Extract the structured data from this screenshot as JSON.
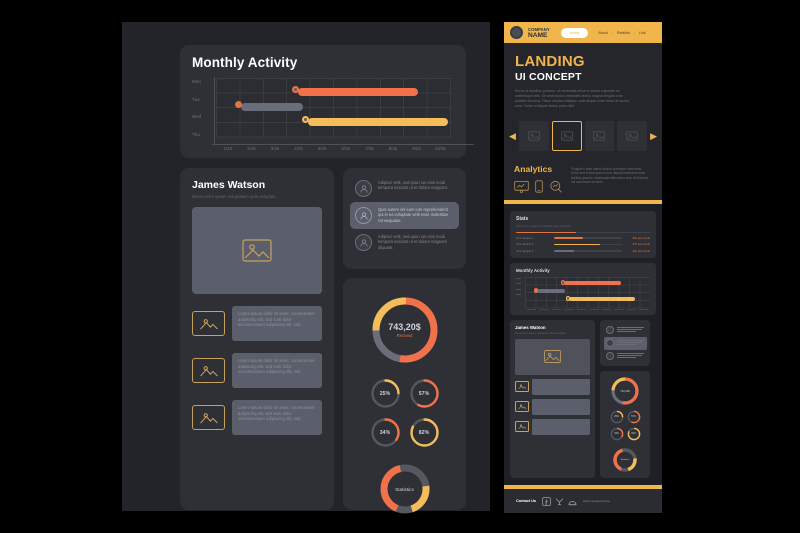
{
  "dashboard": {
    "monthly_activity": {
      "title": "Monthly Activity",
      "y_labels": [
        "Mon",
        "Tue",
        "Wed",
        "Thu"
      ],
      "x_labels": [
        "1/25",
        "2/25",
        "3/25",
        "4/25",
        "5/25",
        "6/25",
        "7/25",
        "8/25",
        "9/25",
        "10/25"
      ]
    },
    "profile": {
      "name": "James Watson",
      "subtitle": "Nemo enim ipsam voluptatem quia voluptas.",
      "image_icon": "image-placeholder-icon",
      "items": [
        {
          "icon": "image-placeholder-icon",
          "text": "Lorem ipsum dolor sit amet, consectetuer adipiscing elit, sed sum dolor siconsectetuer adipiscing elit, sed"
        },
        {
          "icon": "image-placeholder-icon",
          "text": "Lorem ipsum dolor sit amet, consectetuer adipiscing elit, sed sum dolor siconsectetuer adipiscing elit, sed"
        },
        {
          "icon": "image-placeholder-icon",
          "text": "Lorem ipsum dolor sit amet, consectetuer adipiscing elit, sed sum dolor siconsectetuer adipiscing elit, sed"
        }
      ]
    },
    "comments": [
      {
        "avatar": "user-avatar-icon",
        "text": "Adipisci velit, sed quia non eius modi tempora incidunt ut et dolore magnam.",
        "selected": false
      },
      {
        "avatar": "user-avatar-icon",
        "text": "Quis autem vel eum iure reprehenderit qui in ea voluptate velit esse molestiae consequatur.",
        "selected": true
      },
      {
        "avatar": "user-avatar-icon",
        "text": "Adipisci velit, sed quia non eius modi tempora incidunt ut et dolore magnam aliquam.",
        "selected": false
      }
    ],
    "donuts": {
      "main_value": "743,20$",
      "main_caption": "Recived",
      "mini": [
        "25%",
        "57%",
        "34%",
        "82%"
      ],
      "stat_label": "Statistics"
    }
  },
  "landing": {
    "nav": {
      "logo_primary": "COMPANY",
      "logo_secondary": "NAME",
      "logo_icon": "company-logo-icon",
      "cta_label": "Home",
      "links": [
        "About",
        "Portfolio",
        "Link"
      ]
    },
    "hero": {
      "title": "LANDING",
      "subtitle": "UI CONCEPT",
      "body": "Purus ut faucibus pulvinar. Ut venenatis tellus in metus vulputate eu scelerisque felis. Sit amet luctus venenatis lectus magna fringilla urna porttitor rhoncus. Risus ultricies tristique nulla aliquet enim tortor at auctor urna. Tortor id aliquet lectus proin nibh."
    },
    "carousel": {
      "prev_icon": "chevron-left-icon",
      "next_icon": "chevron-right-icon",
      "slides": [
        "slide-1",
        "slide-2",
        "slide-3",
        "slide-4"
      ],
      "active_index": 1
    },
    "analytics": {
      "title": "Analytics",
      "icons": [
        "presentation-chart-icon",
        "mobile-device-icon",
        "search-analysis-icon"
      ],
      "body": "Feugiat in ante metus dictum at tempor commodo. Dolor sed viverra ipsum nunc aliquet bibendum enim facilisis gravida. Malesuada bibendum arcu at tincidunt dui accumsan sit amet."
    },
    "mini_dashboard": {
      "stats": {
        "title": "Stats",
        "subtitle": "Nemo enim ipsam voluptatem quia voluptas.",
        "rows": [
          {
            "label": "Item Sample 1",
            "value": "500 per month",
            "percent": 42,
            "color": "#e0763f"
          },
          {
            "label": "Item Sample 2",
            "value": "370 per month",
            "percent": 68,
            "color": "#f0b64b"
          },
          {
            "label": "Item Sample 3",
            "value": "220 per month",
            "percent": 30,
            "color": "#6a6d76"
          }
        ]
      },
      "monthly_activity": {
        "title": "Monthly Activity"
      },
      "profile": {
        "name": "James Watson",
        "subtitle": "Nemo enim ipsam voluptatem quia voluptas."
      },
      "donuts": {
        "main_value": "743,20$",
        "mini": [
          "25%",
          "57%",
          "34%",
          "82%"
        ],
        "stat_label": "Statistics"
      }
    },
    "footer": {
      "contact_label": "Contact Us",
      "icons": [
        "facebook-icon",
        "twitter-icon",
        "instagram-icon"
      ],
      "website": "www.companyname"
    }
  },
  "chart_data": {
    "type": "bar",
    "title": "Monthly Activity",
    "orientation": "horizontal",
    "categories": [
      "Mon",
      "Tue",
      "Wed",
      "Thu"
    ],
    "x_tick_labels": [
      "1/25",
      "2/25",
      "3/25",
      "4/25",
      "5/25",
      "6/25",
      "7/25",
      "8/25",
      "9/25",
      "10/25"
    ],
    "xlabel": "",
    "ylabel": "",
    "grid": true,
    "legend": "none",
    "series": [
      {
        "name": "Tue",
        "color": "#f0714a",
        "start": 3.6,
        "end": 7.8,
        "row": 1
      },
      {
        "name": "Wed",
        "color": "#6a6d7a",
        "start": 1.1,
        "end": 3.2,
        "row": 2
      },
      {
        "name": "Thu",
        "color": "#f5bd5a",
        "start": 4.0,
        "end": 8.8,
        "row": 3
      }
    ],
    "markers": [
      {
        "row": 1,
        "x": 3.6,
        "color": "#f0714a"
      },
      {
        "row": 2,
        "x": 1.1,
        "color": "#e0763f"
      },
      {
        "row": 3,
        "x": 4.0,
        "color": "#f5bd5a"
      }
    ]
  },
  "chart_data_donuts": {
    "type": "pie",
    "title": "743,20$ Recived",
    "labels": [
      "Segment A",
      "Segment B",
      "Segment C"
    ],
    "values": [
      52,
      26,
      22
    ],
    "colors": [
      "#f0714a",
      "#f5bd5a",
      "#6a6d7a"
    ],
    "mini_gauges": [
      {
        "label": "25%",
        "value": 25,
        "color": "#f5bd5a"
      },
      {
        "label": "57%",
        "value": 57,
        "color": "#f0714a"
      },
      {
        "label": "34%",
        "value": 34,
        "color": "#f0714a"
      },
      {
        "label": "82%",
        "value": 82,
        "color": "#f5bd5a"
      }
    ],
    "statistics_gauge": {
      "label": "Statistics",
      "segments": [
        40,
        22
      ],
      "colors": [
        "#f0714a",
        "#f5bd5a"
      ]
    }
  }
}
